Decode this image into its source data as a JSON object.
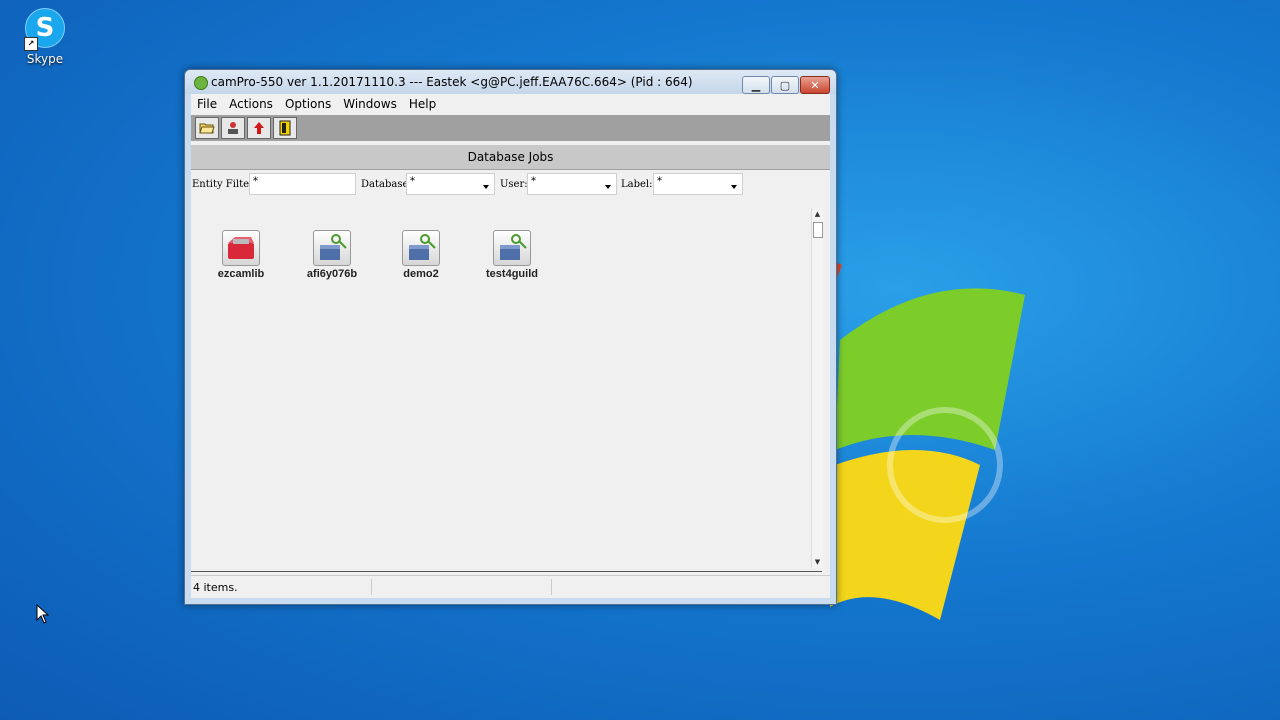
{
  "desktop": {
    "shortcut_label": "Skype"
  },
  "window": {
    "title": "camPro-550 ver 1.1.20171110.3 --- Eastek <g@PC.jeff.EAA76C.664> (Pid : 664)",
    "minimize_glyph": "▁",
    "maximize_glyph": "▢",
    "close_glyph": "✕"
  },
  "menu": {
    "items": [
      "File",
      "Actions",
      "Options",
      "Windows",
      "Help"
    ]
  },
  "toolbar": {
    "buttons": [
      {
        "icon": "folder-open-icon"
      },
      {
        "icon": "users-icon"
      },
      {
        "icon": "upload-arrow-icon"
      },
      {
        "icon": "exit-door-icon"
      }
    ]
  },
  "section": {
    "title": "Database Jobs"
  },
  "filters": {
    "entity_label": "Entity Filter:",
    "entity_value": "*",
    "database_label": "Database:",
    "database_value": "*",
    "user_label": "User:",
    "user_value": "*",
    "label_label": "Label:",
    "label_value": "*"
  },
  "items": [
    {
      "name": "ezcamlib",
      "icon": "library-box-icon",
      "color": "#d8283a"
    },
    {
      "name": "afi6y076b",
      "icon": "database-key-icon",
      "color": "#4a9b2c"
    },
    {
      "name": "demo2",
      "icon": "database-key-icon",
      "color": "#4a9b2c"
    },
    {
      "name": "test4guild",
      "icon": "database-key-icon",
      "color": "#4a9b2c"
    }
  ],
  "status": {
    "text": "4 items."
  }
}
